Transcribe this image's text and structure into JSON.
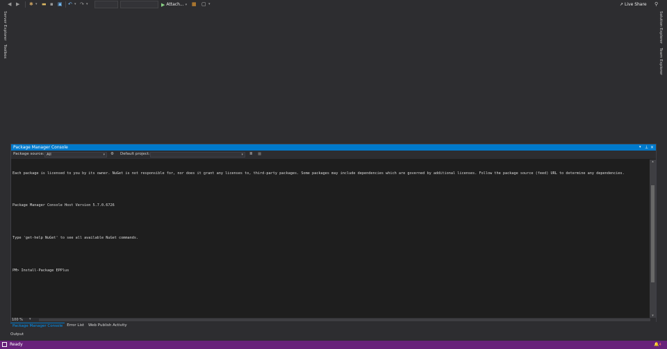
{
  "toolbar": {
    "attach_label": "Attach...",
    "live_share_label": "Live Share",
    "icons": [
      "back-icon",
      "forward-icon",
      "new-project-icon",
      "open-icon",
      "save-icon",
      "save-all-icon",
      "undo-icon",
      "redo-icon",
      "start-icon",
      "browser-link-icon",
      "layout-icon",
      "person-icon"
    ]
  },
  "side_tabs": {
    "left": [
      "Server Explorer",
      "Toolbox"
    ],
    "right": [
      "Solution Explorer",
      "Team Explorer"
    ]
  },
  "pmc": {
    "title": "Package Manager Console",
    "package_source_label": "Package source:",
    "package_source_value": "All",
    "default_project_label": "Default project:",
    "default_project_value": "",
    "output_lines": [
      "Each package is licensed to you by its owner. NuGet is not responsible for, nor does it grant any licenses to, third-party packages. Some packages may include dependencies which are governed by additional licenses. Follow the package source (feed) URL to determine any dependencies.",
      "",
      "Package Manager Console Host Version 5.7.0.6726",
      "",
      "Type 'get-help NuGet' to see all available NuGet commands.",
      "",
      "PM> Install-Package EPPlus"
    ],
    "zoom": "100 %"
  },
  "tool_tabs": [
    "Package Manager Console",
    "Error List",
    "Web Publish Activity"
  ],
  "output_tab": "Output",
  "status": {
    "text": "Ready",
    "notification_count": "4"
  },
  "colors": {
    "accent": "#007acc",
    "status_bar": "#68217a",
    "background": "#2d2d30",
    "console_bg": "#1e1e1e"
  }
}
